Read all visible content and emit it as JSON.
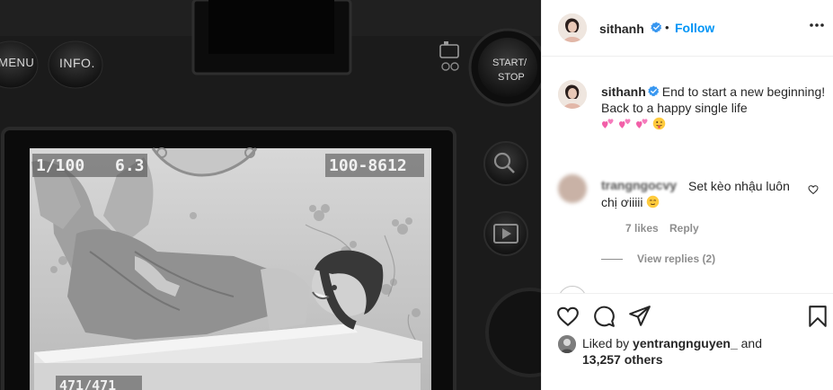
{
  "photo": {
    "camera_buttons": {
      "menu": "MENU",
      "info": "INFO.",
      "start_stop_line1": "START/",
      "start_stop_line2": "STOP"
    },
    "lcd": {
      "shutter": "1/100",
      "aperture": "6.3",
      "file_number": "100-8612",
      "frame_counter": "471/471"
    }
  },
  "header": {
    "username": "sithanh",
    "separator": "•",
    "follow_label": "Follow"
  },
  "caption": {
    "username": "sithanh",
    "text": "End to start a new beginning! Back to a happy single life",
    "emojis": [
      "two-hearts",
      "two-hearts",
      "two-hearts",
      "tongue-face"
    ]
  },
  "comments": [
    {
      "username": "trangngocvy",
      "text": "Set kèo nhậu luôn chị ơiiiii",
      "emoji": "relieved-face",
      "likes": "7 likes",
      "reply_label": "Reply",
      "view_replies": "View replies (2)"
    }
  ],
  "likes": {
    "prefix": "Liked by",
    "liker": "yentrangnguyen_",
    "conjunction": "and",
    "others": "13,257 others"
  },
  "colors": {
    "link_blue": "#0095f6",
    "verified_blue": "#3897f0",
    "muted_text": "#8e8e8e",
    "border": "#efefef"
  }
}
